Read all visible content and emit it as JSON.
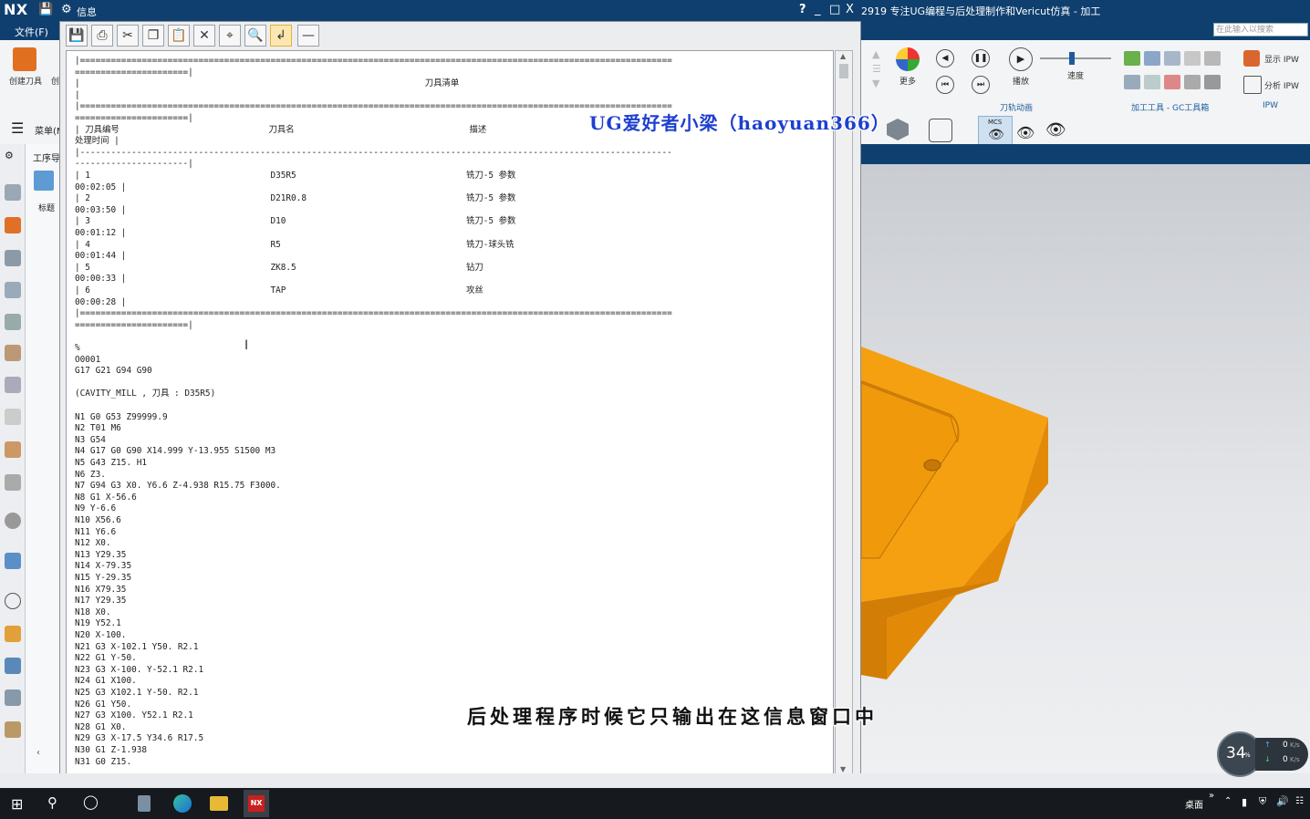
{
  "titlebar": {
    "logo": "NX",
    "info_label": "信息",
    "help": "?",
    "min": "_",
    "restore": "□",
    "close": "X",
    "window_title": "2919  专注UG编程与后处理制作和Vericut仿真 - 加工"
  },
  "menubar": {
    "file": "文件(F)",
    "search_placeholder": "在此输入以搜索"
  },
  "ribbon": {
    "create_tool": "创建刀具",
    "create_short": "创",
    "more": "更多",
    "play": "播放",
    "speed": "速度",
    "group_toolpath": "刀轨动画",
    "group_tools": "加工工具 - GC工具箱",
    "show_ipw": "显示 IPW",
    "analyze_ipw": "分析 IPW",
    "group_ipw": "IPW",
    "mcs": "MCS"
  },
  "toolbar2": {
    "menu": "菜单(M)"
  },
  "navpanel": {
    "header": "工序导",
    "col_title": "标题"
  },
  "info_window": {
    "lines": [
      "|===================================================================================================================",
      "======================|",
      "|                                                                   刀具清单",
      "|",
      "|===================================================================================================================",
      "======================|",
      "| 刀具编号                             刀具名                                  描述",
      "处理时间 |",
      "|-------------------------------------------------------------------------------------------------------------------",
      "----------------------|",
      "| 1                                   D35R5                                 铣刀-5 参数",
      "00:02:05 |",
      "| 2                                   D21R0.8                               铣刀-5 参数",
      "00:03:50 |",
      "| 3                                   D10                                   铣刀-5 参数",
      "00:01:12 |",
      "| 4                                   R5                                    铣刀-球头铣",
      "00:01:44 |",
      "| 5                                   ZK8.5                                 钻刀",
      "00:00:33 |",
      "| 6                                   TAP                                   攻丝",
      "00:00:28 |",
      "|===================================================================================================================",
      "======================|",
      "",
      "%",
      "O0001",
      "G17 G21 G94 G90",
      "",
      "(CAVITY_MILL , 刀具 : D35R5)",
      "",
      "N1 G0 G53 Z99999.9",
      "N2 T01 M6",
      "N3 G54",
      "N4 G17 G0 G90 X14.999 Y-13.955 S1500 M3",
      "N5 G43 Z15. H1",
      "N6 Z3.",
      "N7 G94 G3 X0. Y6.6 Z-4.938 R15.75 F3000.",
      "N8 G1 X-56.6",
      "N9 Y-6.6",
      "N10 X56.6",
      "N11 Y6.6",
      "N12 X0.",
      "N13 Y29.35",
      "N14 X-79.35",
      "N15 Y-29.35",
      "N16 X79.35",
      "N17 Y29.35",
      "N18 X0.",
      "N19 Y52.1",
      "N20 X-100.",
      "N21 G3 X-102.1 Y50. R2.1",
      "N22 G1 Y-50.",
      "N23 G3 X-100. Y-52.1 R2.1",
      "N24 G1 X100.",
      "N25 G3 X102.1 Y-50. R2.1",
      "N26 G1 Y50.",
      "N27 G3 X100. Y52.1 R2.1",
      "N28 G1 X0.",
      "N29 G3 X-17.5 Y34.6 R17.5",
      "N30 G1 Z-1.938",
      "N31 G0 Z15."
    ]
  },
  "watermark": "UG爱好者小梁（haoyuan366）",
  "subtitle": "后处理程序时候它只输出在这信息窗口中",
  "net_widget": {
    "percent": "34",
    "percent_unit": "%",
    "up": "0",
    "down": "0",
    "unit": "K/s"
  },
  "taskbar": {
    "desktop": "桌面",
    "more": "»"
  },
  "colors": {
    "titlebar": "#0f3f6f",
    "part_orange": "#f5a011",
    "taskbar": "#16191d"
  }
}
